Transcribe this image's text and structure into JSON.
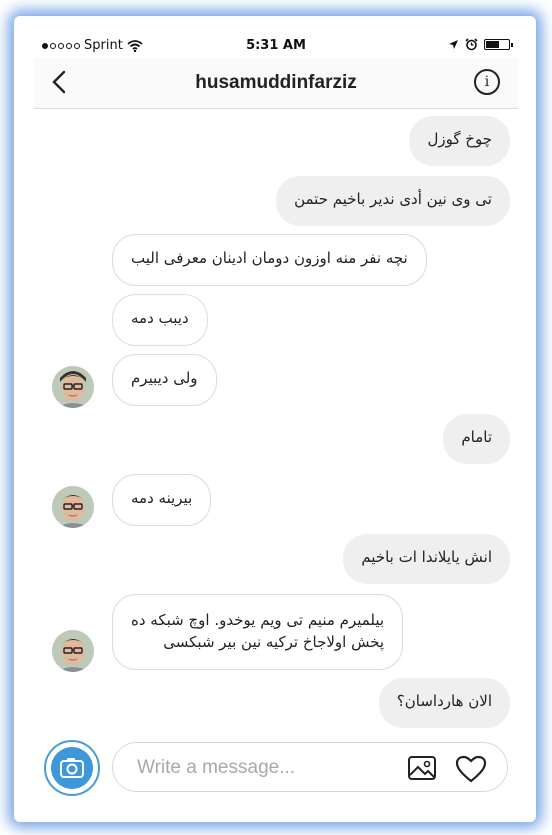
{
  "status_bar": {
    "carrier": "Sprint",
    "time": "5:31 AM",
    "signal_icon": "signal-dots-icon",
    "wifi_icon": "wifi-icon",
    "location_icon": "location-arrow-icon",
    "alarm_icon": "alarm-clock-icon",
    "battery_level": 0.6
  },
  "header": {
    "title": "husamuddinfarziz",
    "back_icon": "chevron-left-icon",
    "info_icon": "info-icon",
    "info_glyph": "i"
  },
  "messages": [
    {
      "side": "outgoing",
      "text": "چوخ گوزل"
    },
    {
      "side": "outgoing",
      "text": "تی وی نین أدی ندیر باخیم حتمن"
    },
    {
      "side": "incoming",
      "text": "نچه نفر منه اوزون دومان ادینان معرفی الیب"
    },
    {
      "side": "incoming",
      "text": "دیبب دمه"
    },
    {
      "side": "incoming",
      "text": "ولی دیبیرم",
      "avatar": true
    },
    {
      "side": "outgoing",
      "text": "تامام"
    },
    {
      "side": "incoming",
      "text": "بیرینه دمه",
      "avatar": true
    },
    {
      "side": "outgoing",
      "text": "انش یایلاندا ات باخیم"
    },
    {
      "side": "incoming",
      "text": "بیلمیرم منیم تی ویم یوخدو. اوچ شبکه ده",
      "text2": "پخش اولاجاخ ترکیه نین بیر شبکسی",
      "avatar": true
    },
    {
      "side": "outgoing",
      "text": "الان هارداسان؟"
    }
  ],
  "composer": {
    "placeholder": "Write a message...",
    "camera_icon": "camera-icon",
    "image_icon": "image-icon",
    "heart_icon": "heart-icon"
  },
  "colors": {
    "frame_glow": "#6096e1",
    "camera_blue": "#3d97d8",
    "outgoing_bubble": "#efefef",
    "incoming_border": "#dcdcdc"
  }
}
